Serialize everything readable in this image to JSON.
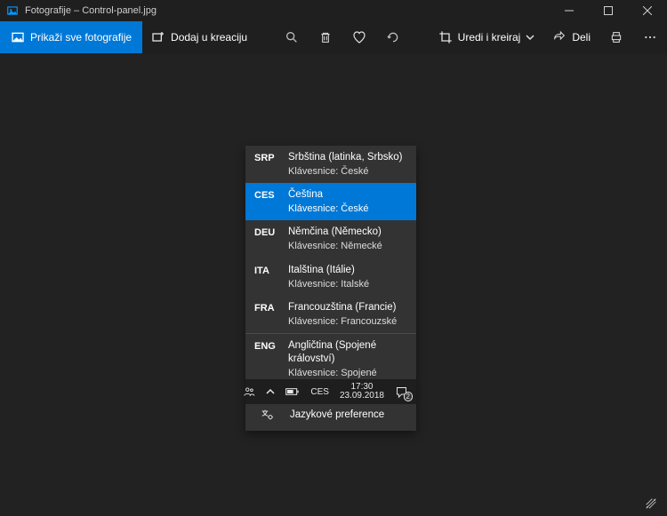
{
  "title": "Fotografije – Control-panel.jpg",
  "toolbar": {
    "show_all": "Prikaži sve fotografije",
    "add_to_creation": "Dodaj u kreaciju",
    "edit_create": "Uredi i kreiraj",
    "share": "Deli"
  },
  "lang": {
    "items": [
      {
        "code": "SRP",
        "name": "Srbština (latinka, Srbsko)",
        "kbd": "Klávesnice: České",
        "selected": false
      },
      {
        "code": "CES",
        "name": "Čeština",
        "kbd": "Klávesnice: České",
        "selected": true
      },
      {
        "code": "DEU",
        "name": "Němčina (Německo)",
        "kbd": "Klávesnice: Německé",
        "selected": false
      },
      {
        "code": "ITA",
        "name": "Italština (Itálie)",
        "kbd": "Klávesnice: Italské",
        "selected": false
      },
      {
        "code": "FRA",
        "name": "Francouzština (Francie)",
        "kbd": "Klávesnice: Francouzské",
        "selected": false
      },
      {
        "code": "ENG",
        "name": "Angličtina (Spojené království)",
        "kbd": "Klávesnice: Spojené království",
        "selected": false
      }
    ],
    "preferences": "Jazykové preference"
  },
  "taskbar": {
    "ime": "CES",
    "time": "17:30",
    "date": "23.09.2018",
    "notification_count": "2"
  }
}
